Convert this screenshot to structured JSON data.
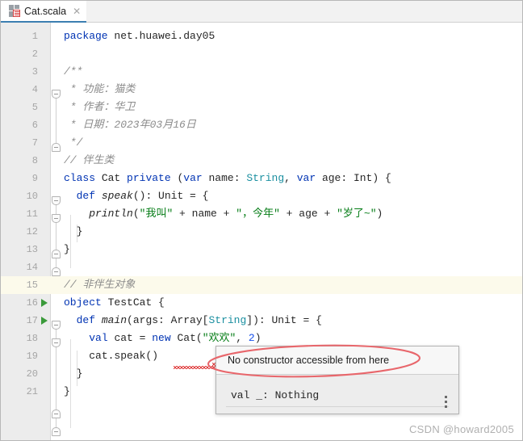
{
  "window": {
    "title": "Cat.scala"
  },
  "tab": {
    "label": "Cat.scala",
    "close_glyph": "✕",
    "icon": "scala-file-icon",
    "active_underline_color": "#3c7fb1"
  },
  "editor": {
    "current_line": 15,
    "run_marker_lines": [
      16,
      17
    ],
    "lines": [
      {
        "n": 1,
        "html": "<span class='kw'>package</span> <span class='plain'>net.huawei.day05</span>"
      },
      {
        "n": 2,
        "html": ""
      },
      {
        "n": 3,
        "html": "<span class='cmt'>/**</span>"
      },
      {
        "n": 4,
        "html": "<span class='cmt'> * 功能：猫类</span>"
      },
      {
        "n": 5,
        "html": "<span class='cmt'> * 作者：华卫</span>"
      },
      {
        "n": 6,
        "html": "<span class='cmt'> * 日期：2023年03月16日</span>"
      },
      {
        "n": 7,
        "html": "<span class='cmt'> */</span>"
      },
      {
        "n": 8,
        "html": "<span class='cmt'>// 伴生类</span>"
      },
      {
        "n": 9,
        "html": "<span class='kw'>class</span> <span class='plain'>Cat</span> <span class='kw'>private</span> <span class='plain'>(</span><span class='kw'>var</span> <span class='plain'>name: </span><span class='type'>String</span><span class='plain'>, </span><span class='kw'>var</span> <span class='plain'>age: Int) {</span>"
      },
      {
        "n": 10,
        "html": "  <span class='kw'>def</span> <span class='fn'>speak</span><span class='plain'>(): Unit = {</span>"
      },
      {
        "n": 11,
        "html": "    <span class='fn'>println</span><span class='plain'>(</span><span class='str'>\"我叫\"</span><span class='plain'> + name + </span><span class='str'>\"，今年\"</span><span class='plain'> + age + </span><span class='str'>\"岁了~\"</span><span class='plain'>)</span>"
      },
      {
        "n": 12,
        "html": "  <span class='plain'>}</span>"
      },
      {
        "n": 13,
        "html": "<span class='plain'>}</span>"
      },
      {
        "n": 14,
        "html": ""
      },
      {
        "n": 15,
        "html": "<span class='cmt'>// 非伴生对象</span>"
      },
      {
        "n": 16,
        "html": "<span class='kw'>object</span> <span class='plain'>TestCat {</span>"
      },
      {
        "n": 17,
        "html": "  <span class='kw'>def</span> <span class='fn'>main</span><span class='plain'>(args: Array[</span><span class='type'>String</span><span class='plain'>]): Unit = {</span>"
      },
      {
        "n": 18,
        "html": "    <span class='kw'>val</span> <span class='plain'>cat = </span><span class='kw'>new</span> <span class='plain'>Cat(</span><span class='str'>\"欢欢\"</span><span class='plain'>, </span><span class='num'>2</span><span class='plain'>)</span>"
      },
      {
        "n": 19,
        "html": "    <span class='plain'>cat.speak()</span>"
      },
      {
        "n": 20,
        "html": "  <span class='plain'>}</span>"
      },
      {
        "n": 21,
        "html": "<span class='plain'>}</span>"
      }
    ]
  },
  "tooltip": {
    "message": "No constructor accessible from here",
    "inferred_type": "val _: Nothing",
    "menu_glyph": "kebab-menu-icon"
  },
  "annotation": {
    "shape": "ellipse",
    "color": "#e8666b"
  },
  "watermark": {
    "text": "CSDN @howard2005"
  }
}
